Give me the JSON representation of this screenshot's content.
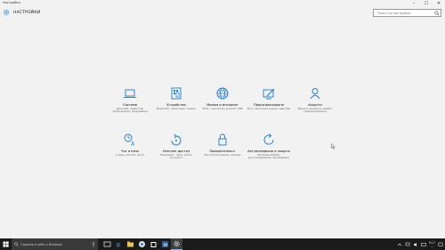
{
  "window": {
    "title": "Настройки"
  },
  "header": {
    "app_title": "НАСТРОЙКИ"
  },
  "search": {
    "placeholder": "Поиск на настройки"
  },
  "tiles": [
    {
      "id": "system",
      "name": "Система",
      "desc": "Дисплей, известия, приложения, захранване",
      "icon": "laptop-icon"
    },
    {
      "id": "devices",
      "name": "Устройства",
      "desc": "Bluetooth, принтери, мишка",
      "icon": "devices-icon"
    },
    {
      "id": "network",
      "name": "Мрежа и интернет",
      "desc": "Wi-Fi, самолетен режим, VPN",
      "icon": "globe-icon"
    },
    {
      "id": "personalization",
      "name": "Персонализиране",
      "desc": "Фон, заключен екран, цветове",
      "icon": "paint-icon"
    },
    {
      "id": "accounts",
      "name": "Акаунти",
      "desc": "Вашите акаунти, имейл, синхронизиране",
      "icon": "person-icon"
    },
    {
      "id": "time",
      "name": "Час и език",
      "desc": "Говор, регион, дата",
      "icon": "clock-language-icon"
    },
    {
      "id": "ease",
      "name": "Улеснен достъп",
      "desc": "Разказвач, лупа, висок контраст",
      "icon": "ease-of-access-icon"
    },
    {
      "id": "privacy",
      "name": "Поверителност",
      "desc": "Местоположение, камера",
      "icon": "lock-icon"
    },
    {
      "id": "update",
      "name": "Актуализиране и защита",
      "desc": "Windows Update, възстановяване, архивиране",
      "icon": "refresh-icon"
    }
  ],
  "taskbar": {
    "search_placeholder": "Търсене в уеба и Windows",
    "tray_time": "9:17",
    "tray_date": "..."
  },
  "colors": {
    "accent": "#1979ca",
    "taskbar": "#1b1b1b"
  }
}
